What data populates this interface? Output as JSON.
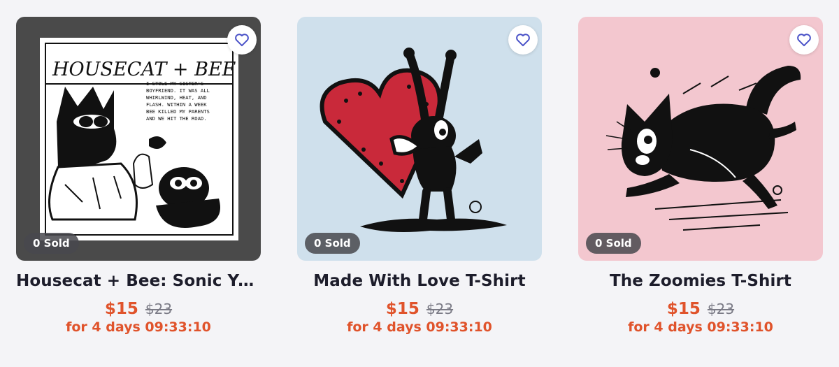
{
  "products": [
    {
      "title": "Housecat + Bee: Sonic You...",
      "sold_badge": "0 Sold",
      "price": "$15",
      "original_price": "$23",
      "countdown": "for 4 days 09:33:10",
      "image_caption": "HOUSECAT + BEE",
      "image_text": [
        "I STOLE MY SISTER'S",
        "BOYFRIEND. IT WAS ALL",
        "WHIRLWIND, HEAT, AND",
        "FLASH. WITHIN A WEEK",
        "BEE KILLED MY PARENTS",
        "AND WE HIT THE ROAD."
      ],
      "background_color": "#4a4a4a"
    },
    {
      "title": "Made With Love T-Shirt",
      "sold_badge": "0 Sold",
      "price": "$15",
      "original_price": "$23",
      "countdown": "for 4 days 09:33:10",
      "background_color": "#cfe0ec"
    },
    {
      "title": "The Zoomies T-Shirt",
      "sold_badge": "0 Sold",
      "price": "$15",
      "original_price": "$23",
      "countdown": "for 4 days 09:33:10",
      "background_color": "#f3c7cf"
    }
  ],
  "colors": {
    "accent": "#e0532b",
    "favorite_icon": "#4a52c8",
    "strike": "#7b7b86"
  }
}
